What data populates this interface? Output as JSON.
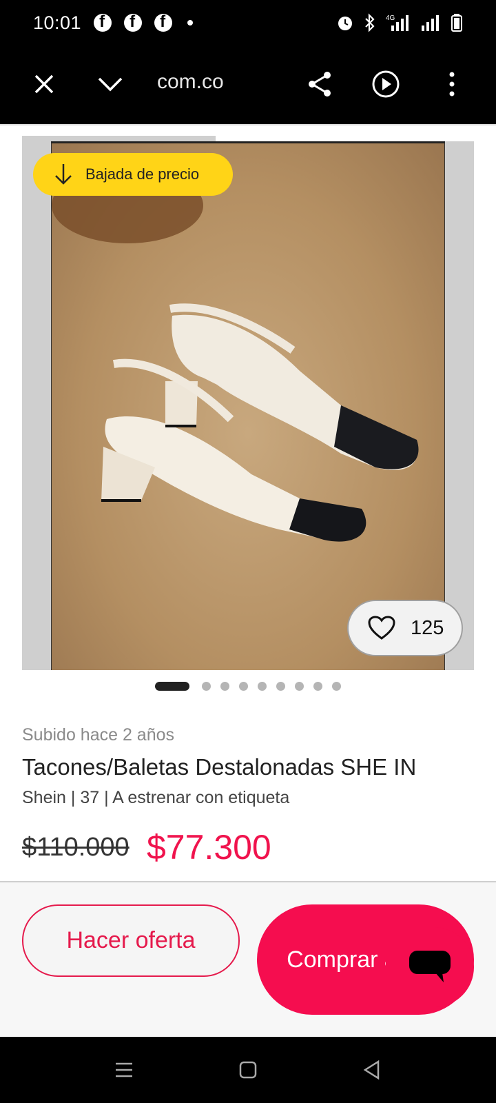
{
  "status_bar": {
    "time": "10:01",
    "icons": [
      "facebook-icon",
      "facebook-icon",
      "facebook-icon",
      "dot-icon",
      "alarm-icon",
      "bluetooth-icon",
      "4g-signal-icon",
      "signal-icon",
      "battery-icon"
    ]
  },
  "browser": {
    "url": "com.co",
    "icons": [
      "close-icon",
      "chevron-down-icon",
      "share-icon",
      "play-icon",
      "more-vert-icon"
    ]
  },
  "gallery": {
    "badge_label": "Bajada de precio",
    "likes": "125",
    "dots_total": 9,
    "active_dot": 0
  },
  "product": {
    "uploaded": "Subido hace 2 años",
    "title": "Tacones/Baletas Destalonadas SHE IN",
    "meta": "Shein | 37 | A estrenar con etiqueta",
    "old_price": "$110.000",
    "new_price": "$77.300"
  },
  "actions": {
    "offer_label": "Hacer oferta",
    "buy_label": "Comprar ahora"
  },
  "colors": {
    "accent": "#f50d4f",
    "badge": "#ffd417"
  }
}
